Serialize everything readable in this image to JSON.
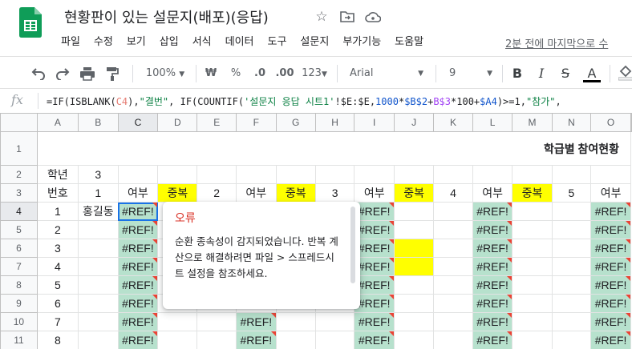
{
  "doc": {
    "title": "현황판이 있는 설문지(배포)(응답)",
    "icons": [
      "star-icon",
      "folder-move-icon",
      "cloud-status-icon"
    ]
  },
  "menu": [
    "파일",
    "수정",
    "보기",
    "삽입",
    "서식",
    "데이터",
    "도구",
    "설문지",
    "부가기능",
    "도움말"
  ],
  "last_edit": "2분 전에 마지막으로 수",
  "toolbar": {
    "zoom": "100%",
    "currency": "₩",
    "percent": "%",
    "decrease_decimal": ".0",
    "increase_decimal": ".00",
    "number_format": "123",
    "font": "Arial",
    "font_size": "9",
    "bold": "B",
    "italic": "I",
    "strike": "S",
    "text_color": "A"
  },
  "formula_bar": {
    "fx": "fx",
    "parts": [
      "=IF(ISBLANK(",
      "C4",
      "),",
      "\"결번\"",
      ", IF(COUNTIF(",
      "'설문지 응답 시트1'",
      "!$E:$E,",
      "1000",
      "*",
      "$B$2",
      "+",
      "B$3",
      "*100+",
      "$A4",
      ")>=1,",
      "\"참가\"",
      ","
    ]
  },
  "columns": [
    "A",
    "B",
    "C",
    "D",
    "E",
    "F",
    "G",
    "H",
    "I",
    "J",
    "K",
    "L",
    "M",
    "N",
    "O"
  ],
  "rows": [
    "1",
    "2",
    "3",
    "4",
    "5",
    "6",
    "7",
    "8",
    "9",
    "10",
    "11"
  ],
  "sheet": {
    "title": "학급별 참여현황",
    "grade_label": "학년",
    "grade_value": "3",
    "header_row": {
      "a": "번호",
      "groups": [
        {
          "class": "1",
          "part": "여부",
          "dup": "중복"
        },
        {
          "class": "2",
          "part": "여부",
          "dup": "중복"
        },
        {
          "class": "3",
          "part": "여부",
          "dup": "중복"
        },
        {
          "class": "4",
          "part": "여부",
          "dup": "중복"
        },
        {
          "class": "5",
          "part": "여부"
        }
      ]
    },
    "numbers": [
      "1",
      "2",
      "3",
      "4",
      "5",
      "6",
      "7",
      "8"
    ],
    "name_row4": "홍길동",
    "ref_error": "#REF!"
  },
  "error_popup": {
    "title": "오류",
    "message": "순환 종속성이 감지되었습니다. 반복 계산으로 해결하려면 파일 > 스프레드시트 설정을 참조하세요."
  }
}
